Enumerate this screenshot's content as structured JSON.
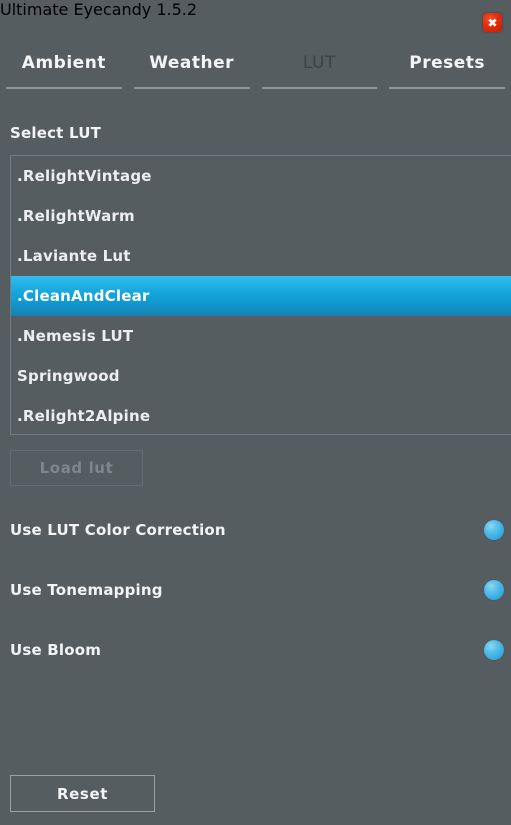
{
  "window": {
    "title": "Ultimate Eyecandy 1.5.2",
    "close_icon": "close-icon",
    "close_glyph": "✖"
  },
  "tabs": [
    {
      "label": "Ambient",
      "active": false
    },
    {
      "label": "Weather",
      "active": false
    },
    {
      "label": "LUT",
      "active": true
    },
    {
      "label": "Presets",
      "active": false
    }
  ],
  "lut_section": {
    "label": "Select LUT",
    "items": [
      {
        "name": ".RelightVintage",
        "selected": false
      },
      {
        "name": ".RelightWarm",
        "selected": false
      },
      {
        "name": ".Laviante Lut",
        "selected": false
      },
      {
        "name": ".CleanAndClear",
        "selected": true
      },
      {
        "name": ".Nemesis LUT",
        "selected": false
      },
      {
        "name": "Springwood",
        "selected": false
      },
      {
        "name": ".Relight2Alpine",
        "selected": false
      }
    ],
    "load_button": {
      "label": "Load lut",
      "enabled": false
    }
  },
  "toggles": [
    {
      "label": "Use LUT Color Correction",
      "state": "on"
    },
    {
      "label": "Use Tonemapping",
      "state": "on"
    },
    {
      "label": "Use Bloom",
      "state": "on"
    }
  ],
  "footer": {
    "reset_label": "Reset"
  },
  "colors": {
    "background": "#555d61",
    "text": "#f2f3f3",
    "accent_blue": "#17a8dd",
    "toggle_blue": "#54bfea",
    "close_red": "#e22d0c",
    "tab_underline": "#8d9599",
    "disabled_text": "#7e878c"
  }
}
